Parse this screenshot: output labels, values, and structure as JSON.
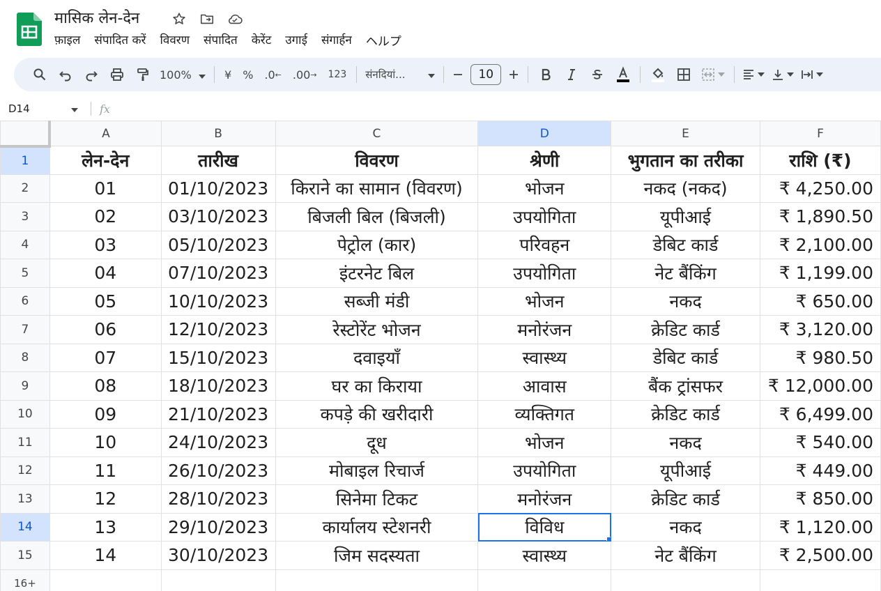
{
  "app": {
    "doc_title": "मासिक लेन-देन",
    "title_icons": [
      "star-icon",
      "move-to-folder-icon",
      "cloud-status-icon"
    ],
    "brand_color": "#0f9d58"
  },
  "menu": [
    "फ़ाइल",
    "संपादित करें",
    "विवरण",
    "संपादित",
    "केरेंट",
    "उगाई",
    "संगार्हन",
    "ヘルプ"
  ],
  "toolbar": {
    "zoom": "100%",
    "currency": "¥",
    "percent": "%",
    "decrease_decimal": ".0",
    "increase_decimal": ".00",
    "number_format": "123",
    "font": "संनदियां...",
    "font_size": "10"
  },
  "formula_bar": {
    "cell_ref": "D14",
    "fx": "fx",
    "content": ""
  },
  "sheet": {
    "columns": [
      "A",
      "B",
      "C",
      "D",
      "E",
      "F"
    ],
    "selected_column": "D",
    "selected_row": "14",
    "headers": [
      "लेन-देन",
      "तारीख",
      "विवरण",
      "श्रेणी",
      "भुगतान का तरीका",
      "राशि (₹)"
    ],
    "rows": [
      {
        "row": "2",
        "cells": [
          "01",
          "01/10/2023",
          "किराने का सामान (विवरण)",
          "भोजन",
          "नकद (नकद)",
          "₹ 4,250.00"
        ]
      },
      {
        "row": "3",
        "cells": [
          "02",
          "03/10/2023",
          "बिजली बिल (बिजली)",
          "उपयोगिता",
          "यूपीआई",
          "₹ 1,890.50"
        ]
      },
      {
        "row": "4",
        "cells": [
          "03",
          "05/10/2023",
          "पेट्रोल (कार)",
          "परिवहन",
          "डेबिट कार्ड",
          "₹ 2,100.00"
        ]
      },
      {
        "row": "5",
        "cells": [
          "04",
          "07/10/2023",
          "इंटरनेट बिल",
          "उपयोगिता",
          "नेट बैंकिंग",
          "₹ 1,199.00"
        ]
      },
      {
        "row": "6",
        "cells": [
          "05",
          "10/10/2023",
          "सब्जी मंडी",
          "भोजन",
          "नकद",
          "₹ 650.00"
        ]
      },
      {
        "row": "7",
        "cells": [
          "06",
          "12/10/2023",
          "रेस्टोरेंट भोजन",
          "मनोरंजन",
          "क्रेडिट कार्ड",
          "₹ 3,120.00"
        ]
      },
      {
        "row": "8",
        "cells": [
          "07",
          "15/10/2023",
          "दवाइयाँ",
          "स्वास्थ्य",
          "डेबिट कार्ड",
          "₹ 980.50"
        ]
      },
      {
        "row": "9",
        "cells": [
          "08",
          "18/10/2023",
          "घर का किराया",
          "आवास",
          "बैंक ट्रांसफर",
          "₹ 12,000.00"
        ]
      },
      {
        "row": "10",
        "cells": [
          "09",
          "21/10/2023",
          "कपड़े की खरीदारी",
          "व्यक्तिगत",
          "क्रेडिट कार्ड",
          "₹ 6,499.00"
        ]
      },
      {
        "row": "11",
        "cells": [
          "10",
          "24/10/2023",
          "दूध",
          "भोजन",
          "नकद",
          "₹ 540.00"
        ]
      },
      {
        "row": "12",
        "cells": [
          "11",
          "26/10/2023",
          "मोबाइल रिचार्ज",
          "उपयोगिता",
          "यूपीआई",
          "₹ 449.00"
        ]
      },
      {
        "row": "13",
        "cells": [
          "12",
          "28/10/2023",
          "सिनेमा टिकट",
          "मनोरंजन",
          "क्रेडिट कार्ड",
          "₹ 850.00"
        ]
      },
      {
        "row": "14",
        "cells": [
          "13",
          "29/10/2023",
          "कार्यालय स्टेशनरी",
          "विविध",
          "नकद",
          "₹ 1,120.00"
        ]
      },
      {
        "row": "15",
        "cells": [
          "14",
          "30/10/2023",
          "जिम सदस्यता",
          "स्वास्थ्य",
          "नेट बैंकिंग",
          "₹ 2,500.00"
        ]
      }
    ],
    "more_rows_label": "16+"
  }
}
